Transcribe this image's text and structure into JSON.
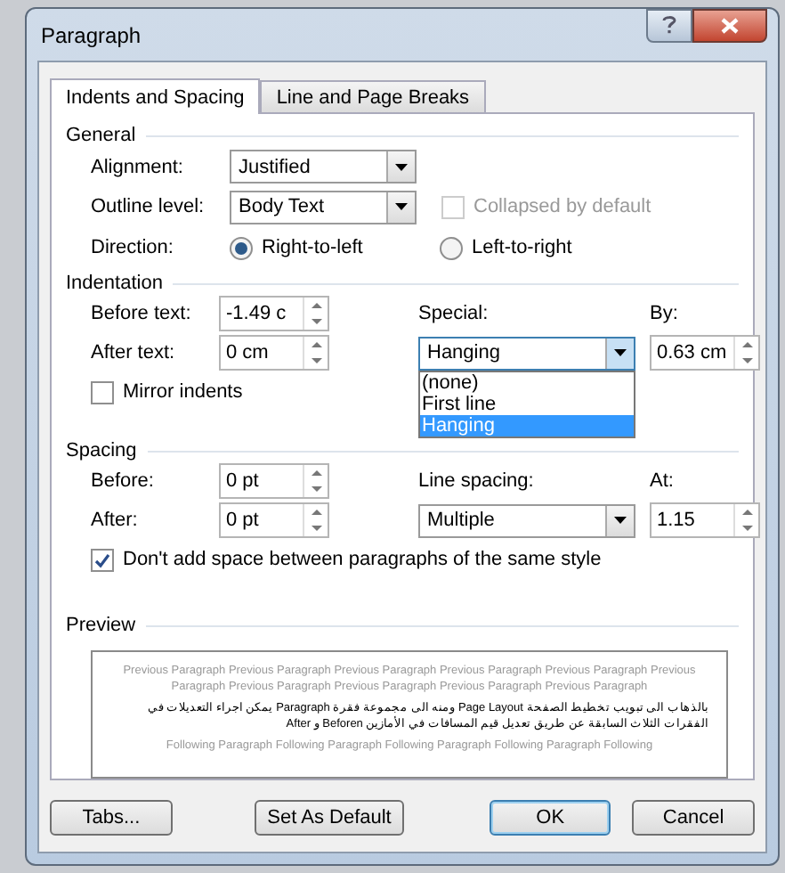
{
  "window": {
    "title": "Paragraph"
  },
  "tabs": [
    {
      "label": "Indents and Spacing",
      "selected": true
    },
    {
      "label": "Line and Page Breaks",
      "selected": false
    }
  ],
  "general": {
    "title": "General",
    "alignment": {
      "label": "Alignment:",
      "value": "Justified"
    },
    "outline_level": {
      "label": "Outline level:",
      "value": "Body Text"
    },
    "collapsed": {
      "label": "Collapsed by default",
      "checked": false,
      "disabled": true
    },
    "direction": {
      "label": "Direction:",
      "options": [
        {
          "label": "Right-to-left",
          "selected": true
        },
        {
          "label": "Left-to-right",
          "selected": false
        }
      ]
    }
  },
  "indentation": {
    "title": "Indentation",
    "before_text": {
      "label": "Before text:",
      "value": "-1.49 c"
    },
    "after_text": {
      "label": "After text:",
      "value": "0 cm"
    },
    "special": {
      "label": "Special:",
      "value": "Hanging",
      "expanded": true,
      "options": [
        {
          "label": "(none)",
          "selected": false
        },
        {
          "label": "First line",
          "selected": false
        },
        {
          "label": "Hanging",
          "selected": true
        }
      ]
    },
    "by": {
      "label": "By:",
      "value": "0.63 cm"
    },
    "mirror": {
      "label": "Mirror indents",
      "checked": false
    }
  },
  "spacing": {
    "title": "Spacing",
    "before": {
      "label": "Before:",
      "value": "0 pt"
    },
    "after": {
      "label": "After:",
      "value": "0 pt"
    },
    "line_spacing": {
      "label": "Line spacing:",
      "value": "Multiple"
    },
    "at": {
      "label": "At:",
      "value": "1.15"
    },
    "dont_add": {
      "label": "Don't add space between paragraphs of the same style",
      "checked": true
    }
  },
  "preview": {
    "title": "Preview",
    "previous_text": "Previous Paragraph Previous Paragraph Previous Paragraph Previous Paragraph Previous Paragraph Previous Paragraph Previous Paragraph Previous Paragraph Previous Paragraph Previous Paragraph",
    "sample_text": "بالذهاب الى تبويب تخطيط الصفحة Page Layout ومنه الى مجموعة فقرة Paragraph يمكن اجراء التعديلات في الفقرات الثلاث السابقة عن طريق تعديل قيم المسافات في الأمازين Beforen و After",
    "following_text": "Following Paragraph Following Paragraph Following Paragraph Following Paragraph Following"
  },
  "buttons": [
    {
      "label": "Tabs...",
      "default": false
    },
    {
      "label": "Set As Default",
      "default": false
    },
    {
      "label": "OK",
      "default": true
    },
    {
      "label": "Cancel",
      "default": false
    }
  ]
}
